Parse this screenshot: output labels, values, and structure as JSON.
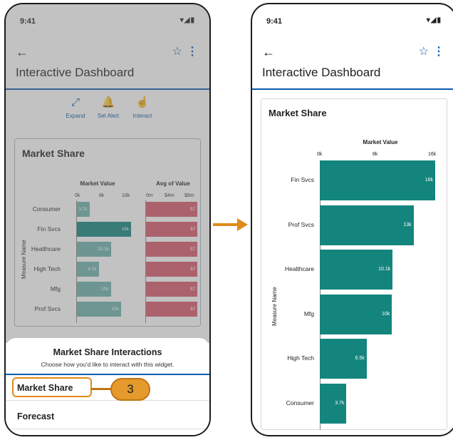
{
  "status": {
    "time": "9:41",
    "icons": "▾◢▮"
  },
  "appbar": {
    "title": "Interactive Dashboard",
    "back_icon": "←",
    "star_icon": "☆",
    "more_icon": "⋮"
  },
  "toolbar": {
    "items": [
      {
        "label": "Expand",
        "icon": "⤢"
      },
      {
        "label": "Set Alert",
        "icon": "🔔"
      },
      {
        "label": "Interact",
        "icon": "☝"
      }
    ]
  },
  "widget": {
    "title": "Market Share",
    "measure_axis_label": "Measure Name",
    "market_value_header": "Market Value",
    "avg_value_header": "Avg of Value",
    "mv_ticks": [
      "0k",
      "8k",
      "16k"
    ],
    "avg_ticks": [
      "0m",
      "$4m",
      "$8m"
    ]
  },
  "sheet": {
    "title": "Market Share Interactions",
    "subtitle": "Choose how you'd like to interact with this widget.",
    "options": [
      "Market Share",
      "Forecast"
    ]
  },
  "callout": {
    "step": "3",
    "accent": "#e08a1c"
  },
  "chart_data": [
    {
      "type": "bar",
      "title": "Market Share",
      "xlabel": "Market Value",
      "ylabel": "Measure Name",
      "categories": [
        "Consumer",
        "Fin Svcs",
        "Healthcare",
        "High Tech",
        "Mfg",
        "Prof Svcs"
      ],
      "series": [
        {
          "name": "Market Value",
          "values": [
            3.7,
            16,
            10.1,
            6.5,
            10,
            13
          ],
          "labels": [
            "3.7k",
            "16k",
            "10.1k",
            "6.5k",
            "10k",
            "13k"
          ]
        },
        {
          "name": "Avg of Value",
          "values": [
            8.8,
            8.8,
            8.8,
            8.8,
            8.8,
            8.8
          ],
          "labels": [
            "$7",
            "$7",
            "$7",
            "$7",
            "$7",
            "$7"
          ]
        }
      ],
      "xlim": [
        0,
        16
      ],
      "highlighted": "Fin Svcs",
      "colors": {
        "market_value": "#14857d",
        "avg": "#d75b6d"
      }
    },
    {
      "type": "bar",
      "title": "Market Share",
      "xlabel": "Market Value",
      "ylabel": "Measure Name",
      "categories": [
        "Fin Svcs",
        "Prof Svcs",
        "Healthcare",
        "Mfg",
        "High Tech",
        "Consumer"
      ],
      "values": [
        16,
        13,
        10.1,
        10,
        6.5,
        3.7
      ],
      "labels": [
        "16k",
        "13k",
        "10.1k",
        "10k",
        "6.5k",
        "3.7k"
      ],
      "ticks": [
        "0k",
        "8k",
        "16k"
      ],
      "xlim": [
        0,
        16
      ],
      "color": "#14857d"
    }
  ]
}
